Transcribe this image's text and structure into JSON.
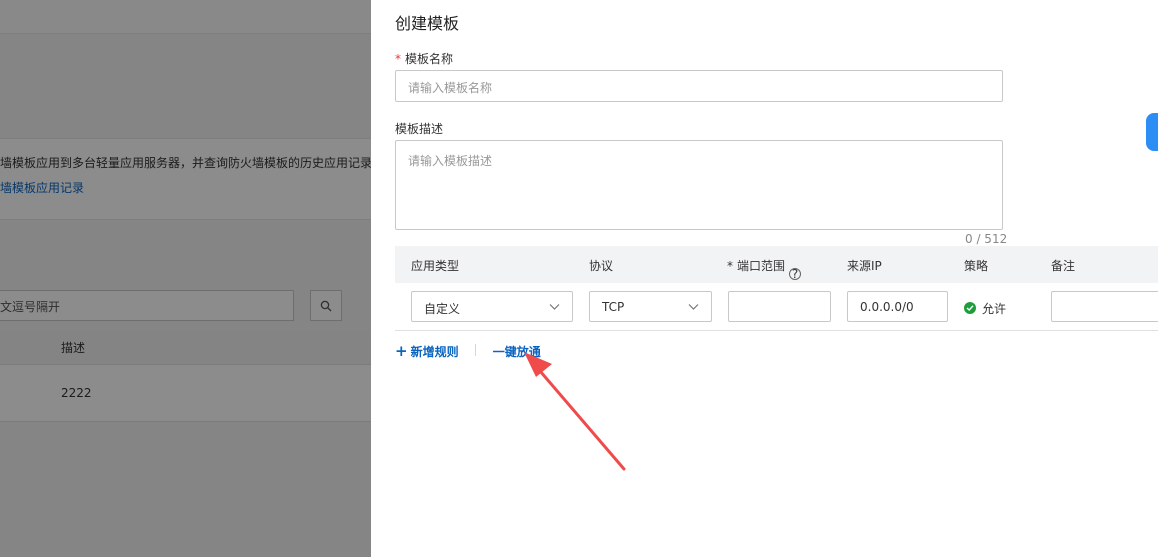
{
  "background": {
    "description_text": "墙模板应用到多台轻量应用服务器，并查询防火墙模板的历史应用记录。",
    "link_text": "墙模板应用记录",
    "search_placeholder": "文逗号隔开",
    "table": {
      "header": "描述",
      "rows": [
        "2222"
      ]
    }
  },
  "drawer": {
    "title": "创建模板",
    "name_field": {
      "required_mark": "*",
      "label": "模板名称",
      "placeholder": "请输入模板名称"
    },
    "desc_field": {
      "label": "模板描述",
      "placeholder": "请输入模板描述",
      "counter": "0 / 512"
    },
    "rules_table": {
      "headers": {
        "app_type": "应用类型",
        "protocol": "协议",
        "port_required_mark": "*",
        "port_range": "端口范围",
        "source_ip": "来源IP",
        "policy": "策略",
        "remark": "备注"
      },
      "rows": [
        {
          "app_type": "自定义",
          "protocol": "TCP",
          "port_range": "",
          "source_ip": "0.0.0.0/0",
          "policy": "允许",
          "remark": ""
        }
      ]
    },
    "actions": {
      "add_rule_icon": "+",
      "add_rule": "新增规则",
      "one_click_allow": "一键放通"
    }
  },
  "icons": {
    "search": "search-icon",
    "chevron": "chevron-down-icon",
    "help": "help-circle-icon",
    "allow": "check-circle-icon",
    "plus": "plus-icon"
  },
  "colors": {
    "link": "#0b64c0",
    "required": "#e4393c",
    "allow_green": "#1f9d3a",
    "annotation_arrow": "#f04b4b"
  }
}
